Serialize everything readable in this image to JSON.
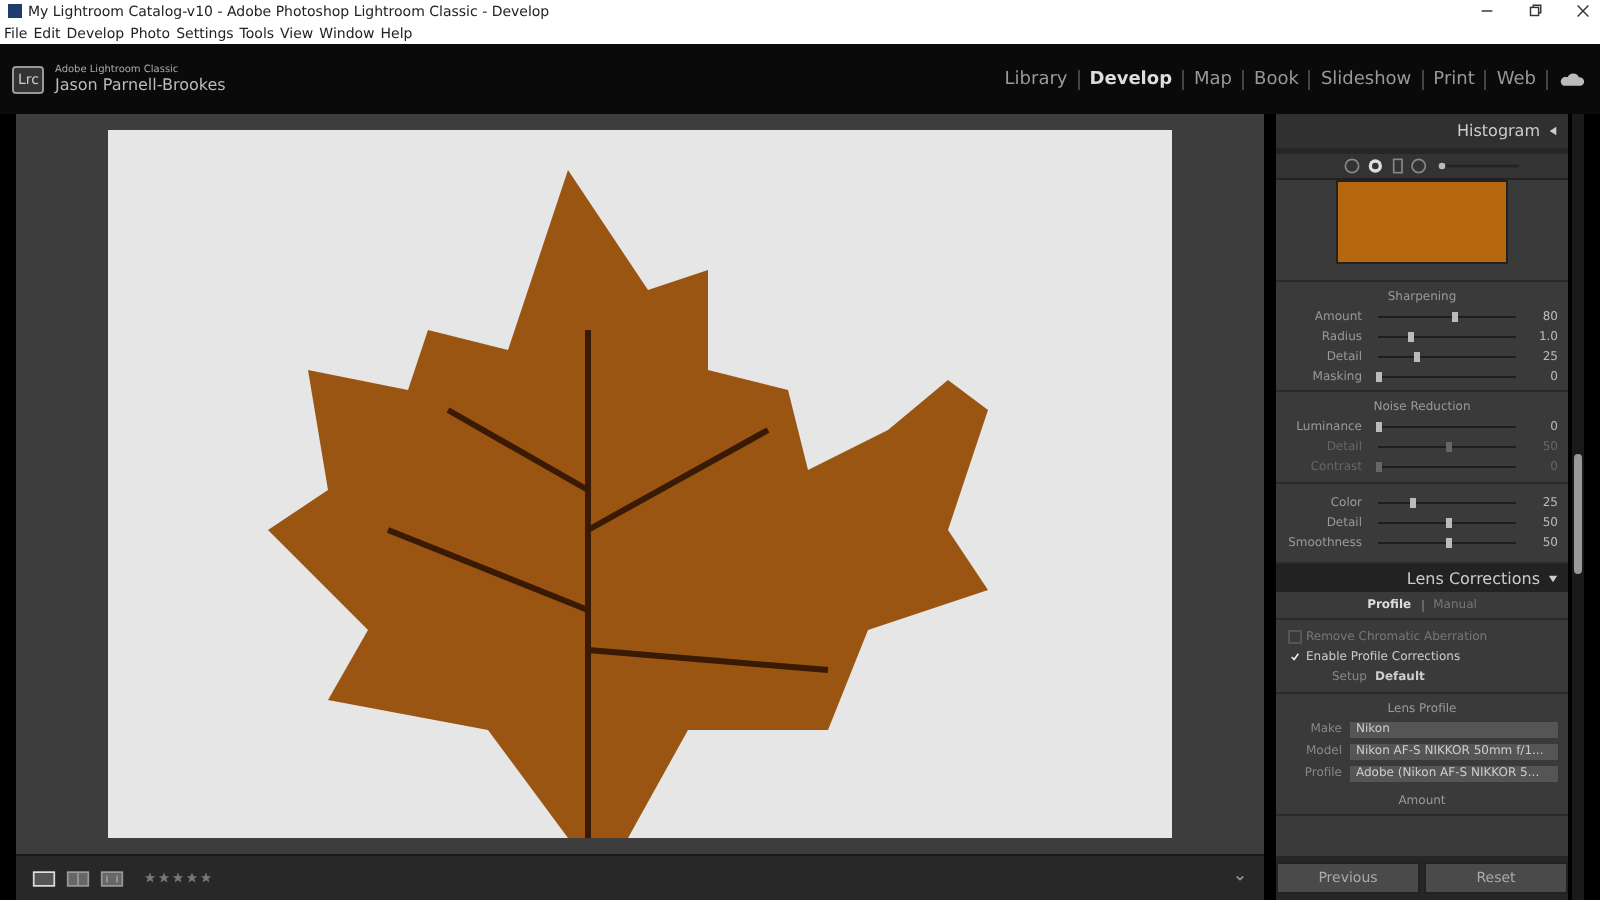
{
  "window": {
    "title": "My Lightroom Catalog-v10 - Adobe Photoshop Lightroom Classic - Develop"
  },
  "menu": [
    "File",
    "Edit",
    "Develop",
    "Photo",
    "Settings",
    "Tools",
    "View",
    "Window",
    "Help"
  ],
  "identity": {
    "badge": "Lrc",
    "product": "Adobe Lightroom Classic",
    "user": "Jason Parnell-Brookes"
  },
  "modules": [
    {
      "label": "Library",
      "selected": false
    },
    {
      "label": "Develop",
      "selected": true
    },
    {
      "label": "Map",
      "selected": false
    },
    {
      "label": "Book",
      "selected": false
    },
    {
      "label": "Slideshow",
      "selected": false
    },
    {
      "label": "Print",
      "selected": false
    },
    {
      "label": "Web",
      "selected": false
    }
  ],
  "panel": {
    "histogram_title": "Histogram",
    "sharpening": {
      "title": "Sharpening",
      "sliders": [
        {
          "label": "Amount",
          "level": 0.55,
          "reading": "80",
          "disabled": false
        },
        {
          "label": "Radius",
          "level": 0.23,
          "reading": "1.0",
          "disabled": false
        },
        {
          "label": "Detail",
          "level": 0.27,
          "reading": "25",
          "disabled": false
        },
        {
          "label": "Masking",
          "level": 0,
          "reading": "0",
          "disabled": false
        }
      ]
    },
    "noise": {
      "title": "Noise Reduction",
      "groups": [
        [
          {
            "label": "Luminance",
            "level": 0,
            "reading": "0",
            "disabled": false
          },
          {
            "label": "Detail",
            "level": 0.5,
            "reading": "50",
            "disabled": true
          },
          {
            "label": "Contrast",
            "level": 0,
            "reading": "0",
            "disabled": true
          }
        ],
        [
          {
            "label": "Color",
            "level": 0.25,
            "reading": "25",
            "disabled": false
          },
          {
            "label": "Detail",
            "level": 0.5,
            "reading": "50",
            "disabled": false
          },
          {
            "label": "Smoothness",
            "level": 0.5,
            "reading": "50",
            "disabled": false
          }
        ]
      ]
    },
    "lens": {
      "title": "Lens Corrections",
      "tabs": [
        {
          "label": "Profile",
          "selected": true
        },
        {
          "label": "Manual",
          "selected": false
        }
      ],
      "checks": [
        {
          "label": "Remove Chromatic Aberration",
          "checked": false
        },
        {
          "label": "Enable Profile Corrections",
          "checked": true
        }
      ],
      "setup": {
        "label": "Setup",
        "value": "Default"
      },
      "profile_title": "Lens Profile",
      "fields": [
        {
          "label": "Make",
          "value": "Nikon"
        },
        {
          "label": "Model",
          "value": "Nikon AF-S NIKKOR 50mm f/1..."
        },
        {
          "label": "Profile",
          "value": "Adobe (Nikon AF-S NIKKOR 5..."
        }
      ],
      "amount_title": "Amount"
    },
    "buttons": [
      "Previous",
      "Reset"
    ]
  },
  "toolbar": {
    "stars": 0
  }
}
